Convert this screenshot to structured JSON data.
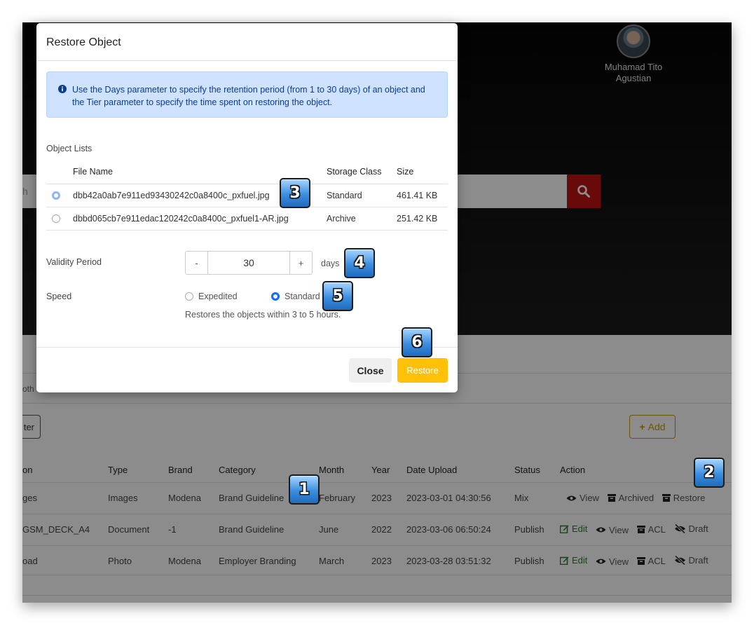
{
  "header": {
    "user_name": "Muhamad Tito Agustian"
  },
  "search": {
    "placeholder_fragment": "h"
  },
  "breadcrumb_fragment": "oth",
  "toolbar": {
    "filter_fragment": "ter",
    "add_label": "Add"
  },
  "table": {
    "headers": [
      "on",
      "Type",
      "Brand",
      "Category",
      "Month",
      "Year",
      "Date Upload",
      "Status",
      "Action"
    ],
    "rows": [
      {
        "name": "ges",
        "type": "Images",
        "brand": "Modena",
        "category": "Brand Guideline",
        "month": "February",
        "year": "2023",
        "date": "2023-03-01 04:30:56",
        "status": "Mix",
        "actions": [
          "View",
          "Archived",
          "Restore"
        ]
      },
      {
        "name": "GSM_DECK_A4",
        "type": "Document",
        "brand": "-1",
        "category": "Brand Guideline",
        "month": "June",
        "year": "2022",
        "date": "2023-03-06 06:50:24",
        "status": "Publish",
        "actions": [
          "Edit",
          "View",
          "ACL",
          "Draft"
        ]
      },
      {
        "name": "oad",
        "type": "Photo",
        "brand": "Modena",
        "category": "Employer Branding",
        "month": "March",
        "year": "2023",
        "date": "2023-03-28 03:51:32",
        "status": "Publish",
        "actions": [
          "Edit",
          "View",
          "ACL",
          "Draft"
        ]
      }
    ]
  },
  "modal": {
    "title": "Restore Object",
    "alert": "Use the Days parameter to specify the retention period (from 1 to 30 days) of an object and the Tier parameter to specify the time spent on restoring the object.",
    "object_lists_label": "Object Lists",
    "columns": {
      "file_name": "File Name",
      "storage_class": "Storage Class",
      "size": "Size"
    },
    "objects": [
      {
        "file_name": "dbb42a0ab7e911ed93430242c0a8400c_pxfuel.jpg",
        "storage_class": "Standard",
        "size": "461.41 KB",
        "selected": true
      },
      {
        "file_name": "dbbd065cb7e911edac120242c0a8400c_pxfuel1-AR.jpg",
        "storage_class": "Archive",
        "size": "251.42 KB",
        "selected": false
      }
    ],
    "validity_label": "Validity Period",
    "minus": "-",
    "plus": "+",
    "days_value": "30",
    "days_unit": "days",
    "speed_label": "Speed",
    "speed_options": [
      "Expedited",
      "Standard"
    ],
    "speed_selected": "Standard",
    "speed_hint": "Restores the objects within 3 to 5 hours.",
    "close_label": "Close",
    "restore_label": "Restore"
  },
  "callouts": [
    "1",
    "2",
    "3",
    "4",
    "5",
    "6"
  ],
  "colors": {
    "accent": "#ffc107",
    "search_button": "#c01313",
    "alert_bg": "#cfe2ff",
    "radio_active": "#0d6efd",
    "callout": "#3c8ee0"
  }
}
